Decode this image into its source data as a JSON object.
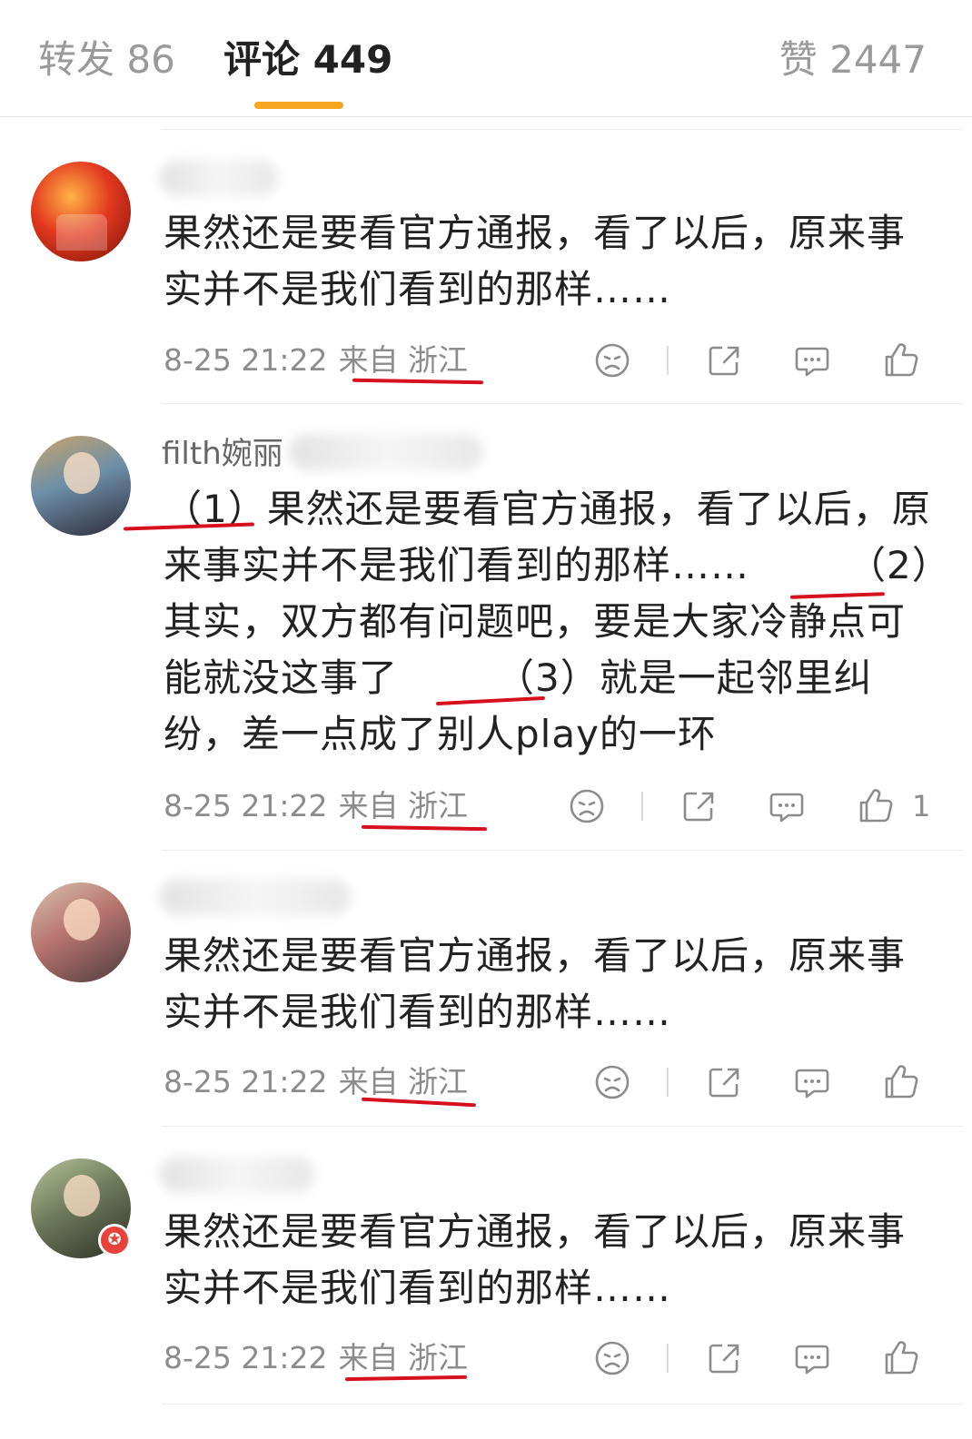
{
  "tabs": {
    "repost": "转发 86",
    "comment": "评论 449",
    "like": "赞 2447"
  },
  "comments": [
    {
      "username": "",
      "text": "果然还是要看官方通报，看了以后，原来事实并不是我们看到的那样……",
      "time": "8-25 21:22",
      "location": "来自 浙江",
      "likes": ""
    },
    {
      "username": "filth婉丽",
      "text": "（1）果然还是要看官方通报，看了以后，原来事实并不是我们看到的那样……　　　（2）其实，双方都有问题吧，要是大家冷静点可能就没这事了　　　（3）就是一起邻里纠纷，差一点成了别人play的一环",
      "time": "8-25 21:22",
      "location": "来自 浙江",
      "likes": "1"
    },
    {
      "username": "",
      "text": "果然还是要看官方通报，看了以后，原来事实并不是我们看到的那样……",
      "time": "8-25 21:22",
      "location": "来自 浙江",
      "likes": ""
    },
    {
      "username": "",
      "text": "果然还是要看官方通报，看了以后，原来事实并不是我们看到的那样……",
      "time": "8-25 21:22",
      "location": "来自 浙江",
      "likes": ""
    }
  ],
  "colors": {
    "accent": "#f5a623",
    "annotation_red": "#d7101e",
    "muted_text": "#8c8c8c"
  },
  "icons": [
    "dislike-face-icon",
    "share-icon",
    "reply-bubble-icon",
    "thumbs-up-icon"
  ]
}
